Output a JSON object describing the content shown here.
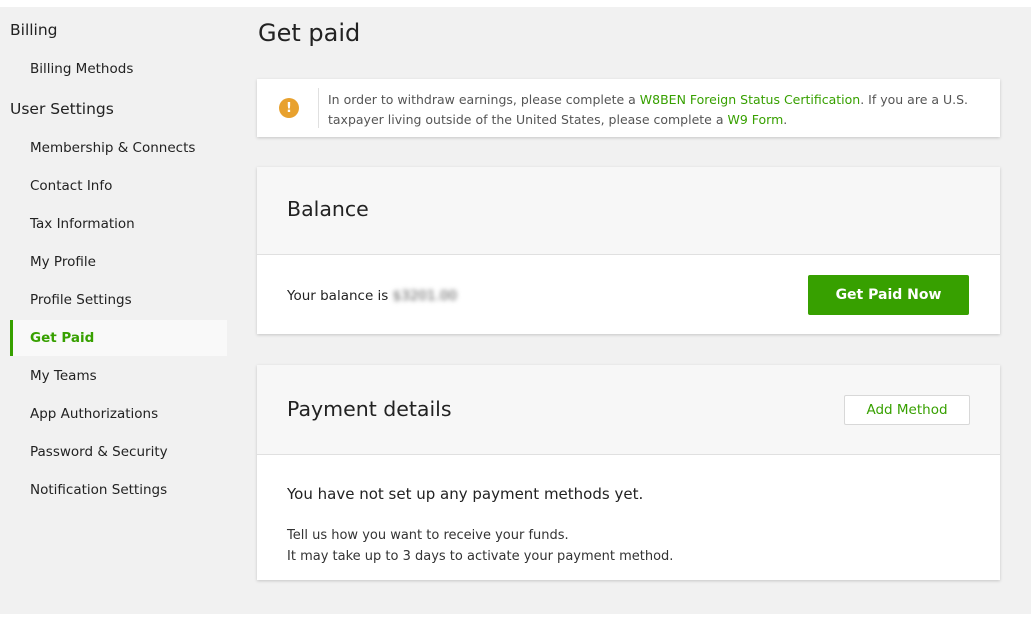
{
  "sidebar": {
    "billing_heading": "Billing",
    "billing_items": [
      {
        "label": "Billing Methods"
      }
    ],
    "user_settings_heading": "User Settings",
    "user_items": [
      {
        "label": "Membership & Connects",
        "active": false
      },
      {
        "label": "Contact Info",
        "active": false
      },
      {
        "label": "Tax Information",
        "active": false
      },
      {
        "label": "My Profile",
        "active": false
      },
      {
        "label": "Profile Settings",
        "active": false
      },
      {
        "label": "Get Paid",
        "active": true
      },
      {
        "label": "My Teams",
        "active": false
      },
      {
        "label": "App Authorizations",
        "active": false
      },
      {
        "label": "Password & Security",
        "active": false
      },
      {
        "label": "Notification Settings",
        "active": false
      }
    ]
  },
  "main": {
    "title": "Get paid",
    "alert": {
      "icon": "exclamation-circle-icon",
      "text_before": "In order to withdraw earnings, please complete a ",
      "link1": "W8BEN Foreign Status Certification",
      "text_middle": ". If you are a U.S. taxpayer living outside of the United States, please complete a ",
      "link2": "W9 Form",
      "text_after": "."
    },
    "balance": {
      "heading": "Balance",
      "label": "Your balance is",
      "amount": "$3201.00",
      "button": "Get Paid Now"
    },
    "payment": {
      "heading": "Payment details",
      "add_button": "Add Method",
      "empty_title": "You have not set up any payment methods yet.",
      "hint1": "Tell us how you want to receive your funds.",
      "hint2": "It may take up to 3 days to activate your payment method."
    }
  },
  "colors": {
    "accent": "#37a000",
    "warning": "#e8a12e",
    "background": "#f1f1f1"
  }
}
